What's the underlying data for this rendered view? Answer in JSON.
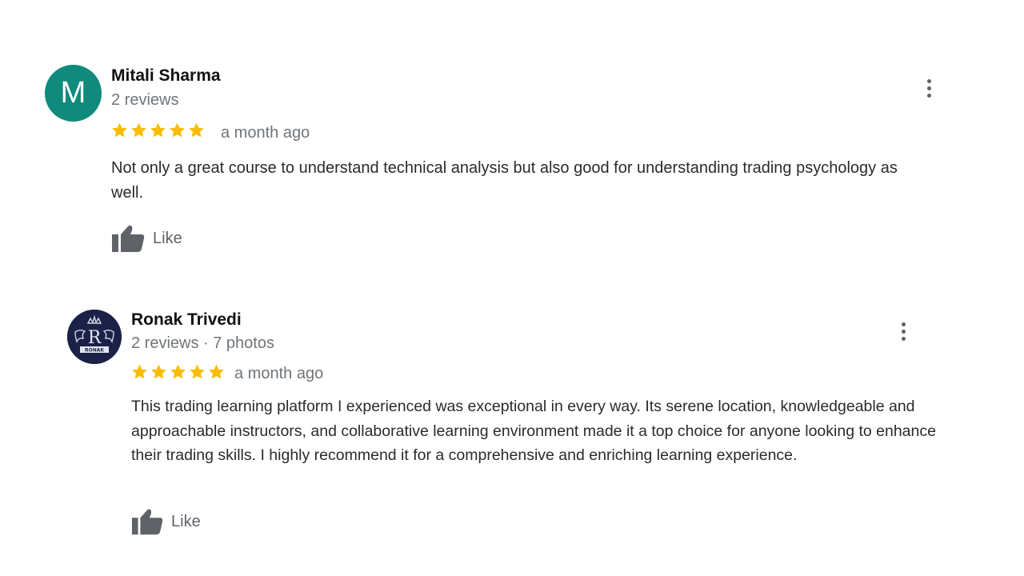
{
  "colors": {
    "star": "#fbbc04",
    "avatar_m": "#0f8a7d",
    "avatar_r": "#1b2147",
    "meta_text": "#70757a"
  },
  "reviews": [
    {
      "avatar_letter": "M",
      "name": "Mitali Sharma",
      "meta": "2 reviews",
      "rating": 5,
      "date": "a month ago",
      "text": "Not only a great course to understand technical analysis but also good for understanding trading psychology as well.",
      "like_label": "Like"
    },
    {
      "avatar_logo_text": "RONAK",
      "avatar_letter": "R",
      "name": "Ronak Trivedi",
      "meta": "2 reviews · 7 photos",
      "rating": 5,
      "date": "a month ago",
      "text": "This trading learning platform I experienced was exceptional in every way. Its serene location, knowledgeable and approachable instructors, and collaborative learning environment made it a top choice for anyone looking to enhance their trading skills. I highly recommend it for a comprehensive and enriching learning experience.",
      "like_label": "Like"
    }
  ],
  "icons": {
    "star": "star-icon",
    "like": "thumbs-up-icon",
    "more": "more-vert-icon"
  }
}
